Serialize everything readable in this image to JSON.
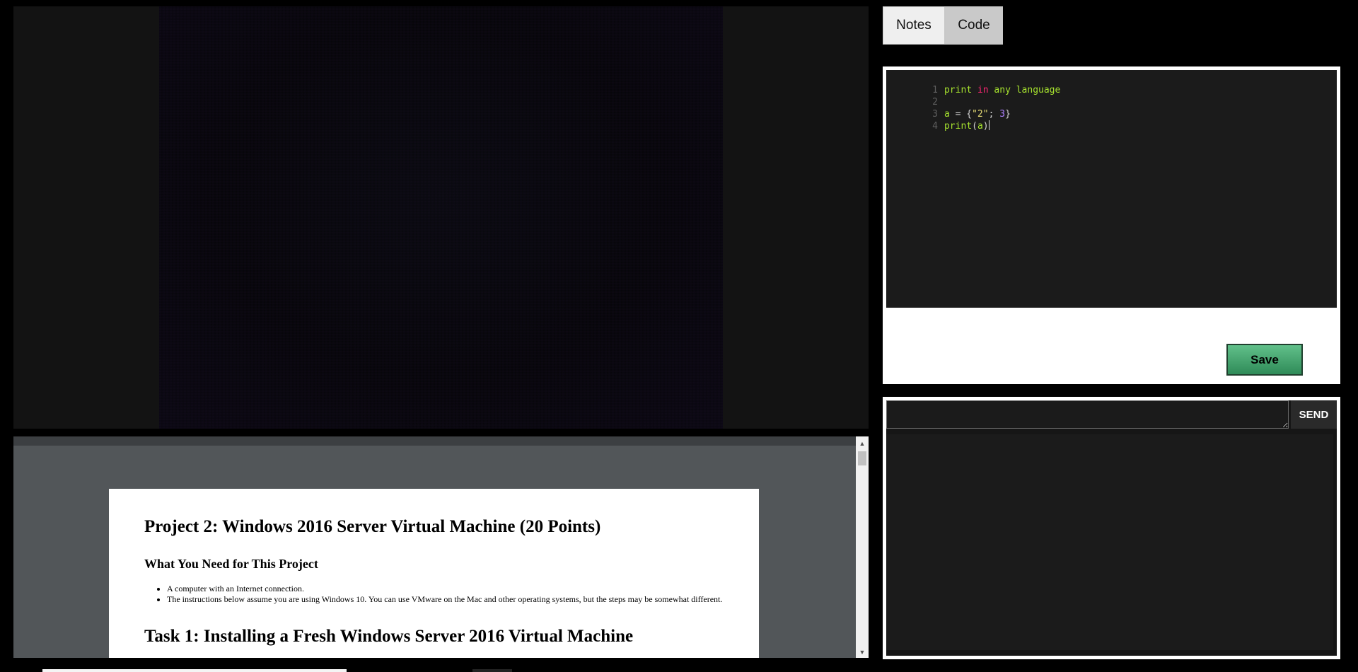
{
  "tabs": {
    "notes_label": "Notes",
    "code_label": "Code"
  },
  "code_editor": {
    "lines": [
      {
        "number": "1",
        "tokens": [
          {
            "t": "print",
            "c": "t-fn"
          },
          {
            "t": " "
          },
          {
            "t": "in",
            "c": "t-kw"
          },
          {
            "t": " any language",
            "c": "t-id"
          }
        ]
      },
      {
        "number": "2",
        "tokens": []
      },
      {
        "number": "3",
        "tokens": [
          {
            "t": "a",
            "c": "t-id"
          },
          {
            "t": " = {",
            "c": "t-op"
          },
          {
            "t": "\"2\"",
            "c": "t-str"
          },
          {
            "t": "; ",
            "c": "t-op"
          },
          {
            "t": "3",
            "c": "t-num"
          },
          {
            "t": "}",
            "c": "t-op"
          }
        ]
      },
      {
        "number": "4",
        "tokens": [
          {
            "t": "print",
            "c": "t-fn"
          },
          {
            "t": "(",
            "c": "t-op"
          },
          {
            "t": "a",
            "c": "t-id"
          },
          {
            "t": ")",
            "c": "t-op"
          }
        ]
      }
    ],
    "save_label": "Save"
  },
  "chat": {
    "input_value": "",
    "send_label": "SEND"
  },
  "document": {
    "title": "Project 2: Windows 2016 Server Virtual Machine (20 Points)",
    "subtitle": "What You Need for This Project",
    "bullets": [
      "A computer with an Internet connection.",
      "The instructions below assume you are using Windows 10. You can use VMware on the Mac and other operating systems, but the steps may be somewhat different."
    ],
    "task_heading": "Task 1: Installing a Fresh Windows Server 2016 Virtual Machine"
  },
  "scrollbar": {
    "up_arrow": "▲",
    "down_arrow": "▼"
  },
  "colors": {
    "save_button": "#3aa06a",
    "editor_background": "#1b1b1b",
    "document_viewer_background": "#525659"
  }
}
